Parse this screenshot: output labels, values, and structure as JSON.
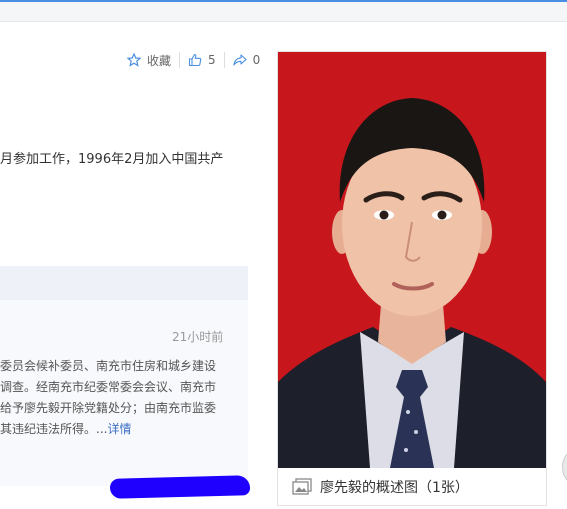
{
  "actions": {
    "collect_label": "收藏",
    "like_count": "5",
    "share_count": "0"
  },
  "intro": {
    "text": "月参加工作，1996年2月加入中国共产"
  },
  "news": {
    "time": "21小时前",
    "lines": [
      "委员会候补委员、南充市住房和城乡建设",
      "调查。经南充市纪委常委会会议、南充市",
      "给予廖先毅开除党籍处分；由南充市监委",
      "其违纪违法所得。..."
    ],
    "more_label": "详情"
  },
  "album": {
    "caption": "廖先毅的概述图（1张）",
    "background_color": "#c8161d"
  },
  "colors": {
    "accent": "#3a6fc4",
    "redaction": "#1f00ff"
  }
}
